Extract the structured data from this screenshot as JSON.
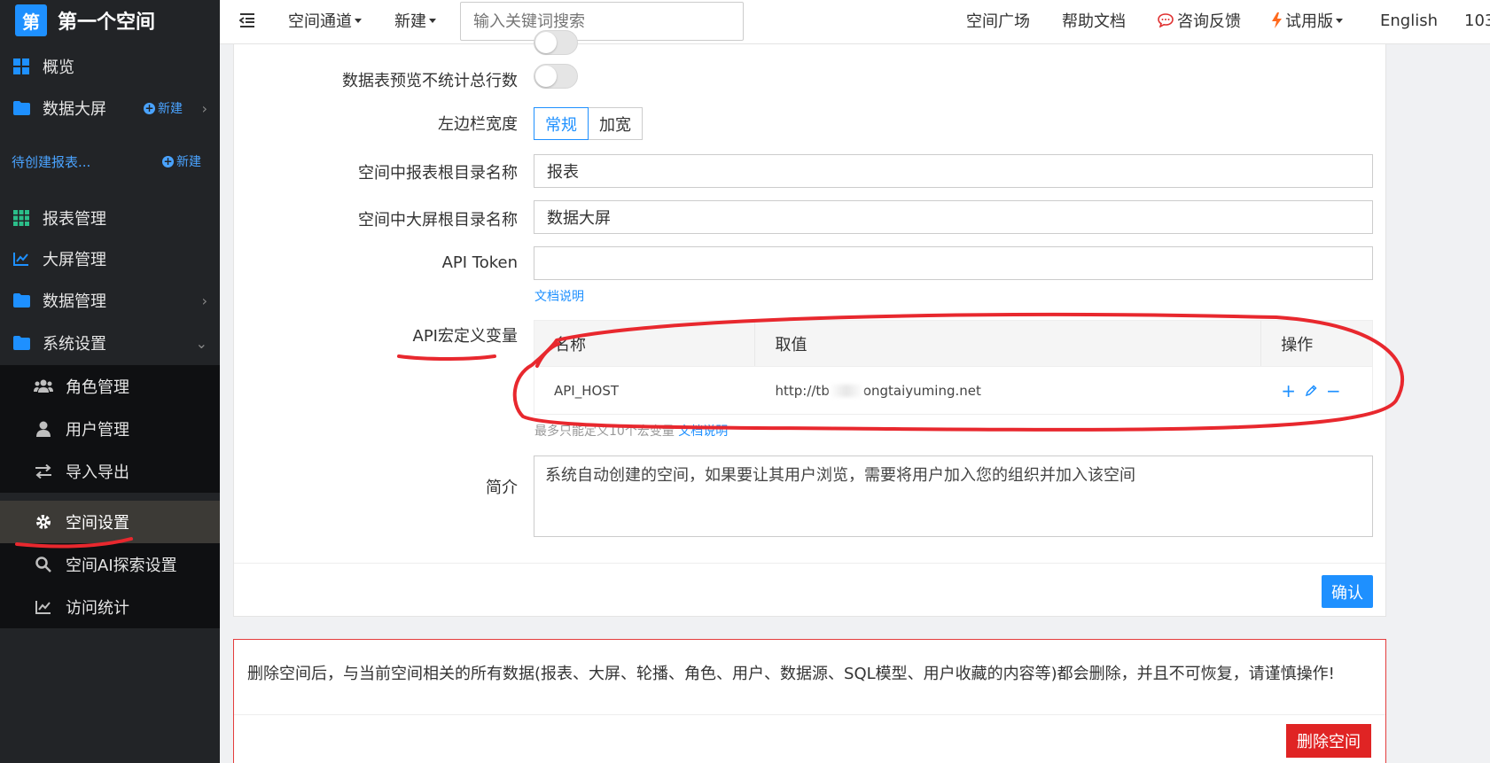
{
  "sidebar": {
    "logo_badge": "第",
    "logo_title": "第一个空间",
    "items": [
      {
        "label": "概览"
      },
      {
        "label": "数据大屏",
        "new": "新建"
      },
      {
        "label": "报表管理"
      },
      {
        "label": "大屏管理"
      },
      {
        "label": "数据管理"
      },
      {
        "label": "系统设置"
      }
    ],
    "pending": "待创建报表...",
    "pending_new": "新建",
    "sub_items": [
      {
        "label": "角色管理"
      },
      {
        "label": "用户管理"
      },
      {
        "label": "导入导出"
      },
      {
        "label": "空间设置"
      },
      {
        "label": "空间AI探索设置"
      },
      {
        "label": "访问统计"
      }
    ]
  },
  "topbar": {
    "menu_channel": "空间通道",
    "menu_new": "新建",
    "search_placeholder": "输入关键词搜索",
    "square": "空间广场",
    "help": "帮助文档",
    "feedback": "咨询反馈",
    "trial": "试用版",
    "language": "English",
    "user_partial": "103"
  },
  "form": {
    "preview_count_label": "数据表预览不统计总行数",
    "sidebar_width_label": "左边栏宽度",
    "sidebar_width_options": [
      "常规",
      "加宽"
    ],
    "report_root_label": "空间中报表根目录名称",
    "report_root_value": "报表",
    "screen_root_label": "空间中大屏根目录名称",
    "screen_root_value": "数据大屏",
    "api_token_label": "API Token",
    "api_token_value": "",
    "doc_link": "文档说明",
    "macro_label": "API宏定义变量",
    "macro_table": {
      "headers": [
        "名称",
        "取值",
        "操作"
      ],
      "rows": [
        {
          "name": "API_HOST",
          "value": "http://tb",
          "value_tail": "ongtaiyuming.net"
        }
      ]
    },
    "macro_hint": "最多只能定义10个宏变量",
    "macro_hint_link": "文档说明",
    "intro_label": "简介",
    "intro_value": "系统自动创建的空间，如果要让其用户浏览，需要将用户加入您的组织并加入该空间",
    "confirm": "确认"
  },
  "danger": {
    "warning": "删除空间后，与当前空间相关的所有数据(报表、大屏、轮播、角色、用户、数据源、SQL模型、用户收藏的内容等)都会删除，并且不可恢复，请谨慎操作!",
    "delete_button": "删除空间"
  },
  "colors": {
    "accent": "#1e90ff",
    "sidebar_bg": "#222427",
    "danger": "#e02424",
    "annotation": "#e8282e"
  }
}
